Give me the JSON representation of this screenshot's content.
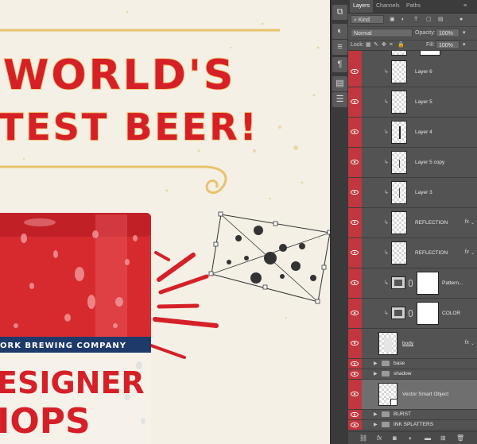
{
  "canvas": {
    "headline_line1": "WORLD'S",
    "headline_line2": "TEST BEER!",
    "can_band_text": "ORK BREWING COMPANY",
    "can_title_line1": "ESIGNER",
    "can_title_line2": "IOPS"
  },
  "toolstrip": {
    "tools": [
      "history-icon",
      "adjust-icon",
      "sliders-icon",
      "paragraph-icon",
      "layers-icon",
      "notes-icon"
    ]
  },
  "panel": {
    "tabs": [
      "Layers",
      "Channels",
      "Paths"
    ],
    "filter_placeholder": "Kind",
    "blend_mode": "Normal",
    "opacity_label": "Opacity:",
    "opacity_value": "100%",
    "lock_label": "Lock:",
    "fill_label": "Fill:",
    "fill_value": "100%",
    "layers": [
      {
        "name": "Layer 6",
        "kind": "clipped"
      },
      {
        "name": "Layer 5",
        "kind": "clipped"
      },
      {
        "name": "Layer 4",
        "kind": "clipped"
      },
      {
        "name": "Layer 5 copy",
        "kind": "clipped"
      },
      {
        "name": "Layer 3",
        "kind": "clipped"
      },
      {
        "name": "REFLECTION",
        "kind": "clipped",
        "fx": "fx"
      },
      {
        "name": "REFLECTION",
        "kind": "clipped",
        "fx": "fx"
      },
      {
        "name": "Pattern...",
        "kind": "fill"
      },
      {
        "name": "COLOR",
        "kind": "fill"
      },
      {
        "name": "body",
        "kind": "normal",
        "fx": "fx"
      },
      {
        "name": "base",
        "kind": "group"
      },
      {
        "name": "shadow",
        "kind": "group"
      },
      {
        "name": "Vector Smart Object",
        "kind": "smart"
      },
      {
        "name": "BURST",
        "kind": "group"
      },
      {
        "name": "INK SPLATTERS",
        "kind": "group"
      }
    ]
  },
  "colors": {
    "brand_red": "#d62027",
    "gold": "#e8c36a",
    "cream": "#f4f0e6",
    "eye_column": "#c2363f"
  }
}
